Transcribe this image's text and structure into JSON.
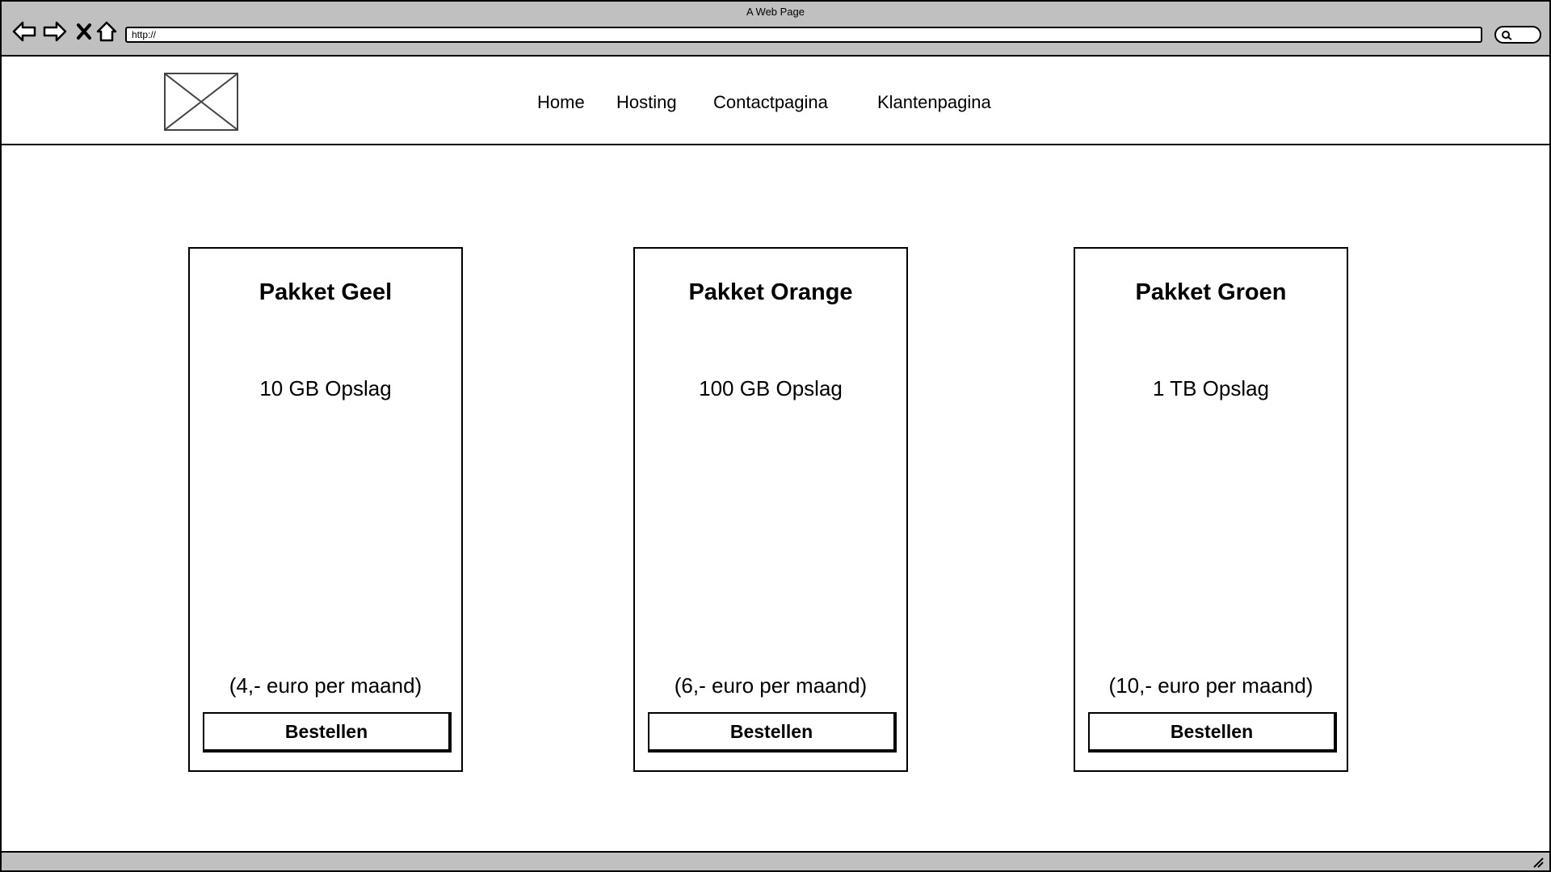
{
  "browser": {
    "window_title": "A Web Page",
    "url": "http://",
    "icons": [
      "back-arrow-icon",
      "forward-arrow-icon",
      "close-icon",
      "home-icon",
      "search-icon",
      "resize-grip-icon"
    ]
  },
  "header": {
    "logo_icon": "image-placeholder-icon",
    "nav": [
      {
        "label": "Home"
      },
      {
        "label": "Hosting"
      },
      {
        "label": "Contactpagina"
      },
      {
        "label": "Klantenpagina"
      }
    ]
  },
  "packages": [
    {
      "title": "Pakket Geel",
      "storage": "10 GB Opslag",
      "price": "(4,- euro per maand)",
      "button_label": "Bestellen"
    },
    {
      "title": "Pakket Orange",
      "storage": "100 GB Opslag",
      "price": "(6,- euro per maand)",
      "button_label": "Bestellen"
    },
    {
      "title": "Pakket Groen",
      "storage": "1 TB Opslag",
      "price": "(10,- euro per maand)",
      "button_label": "Bestellen"
    }
  ],
  "colors": {
    "chrome": "#c0c0c0",
    "border": "#000000",
    "background": "#ffffff"
  }
}
